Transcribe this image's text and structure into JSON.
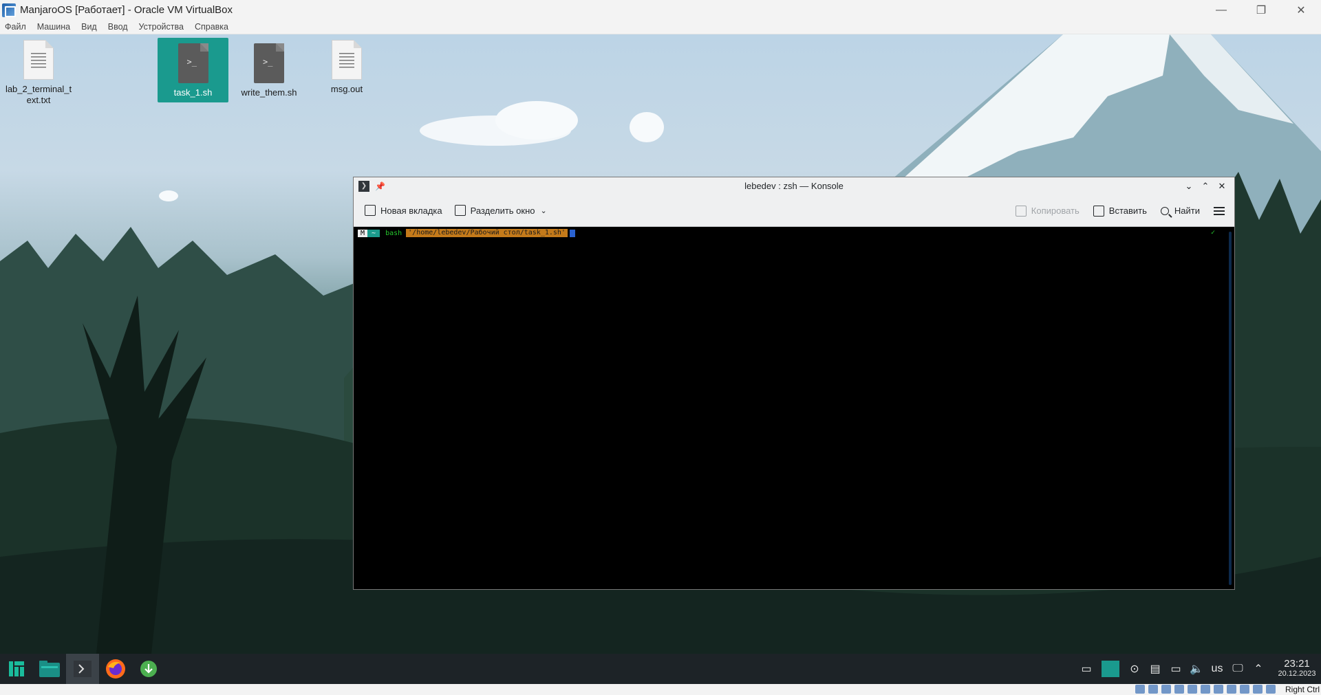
{
  "host_window": {
    "title": "ManjaroOS [Работает] - Oracle VM VirtualBox",
    "controls": {
      "minimize": "—",
      "restore": "❐",
      "close": "✕"
    },
    "menu": [
      "Файл",
      "Машина",
      "Вид",
      "Ввод",
      "Устройства",
      "Справка"
    ]
  },
  "desktop": {
    "icons": [
      {
        "label": "lab_2_terminal_text.txt",
        "type": "text-file-icon",
        "selected": false
      },
      {
        "label": "task_1.sh",
        "type": "script-file-icon",
        "selected": true
      },
      {
        "label": "write_them.sh",
        "type": "script-file-icon",
        "selected": false
      },
      {
        "label": "msg.out",
        "type": "text-file-icon",
        "selected": false
      }
    ]
  },
  "konsole": {
    "title": "lebedev : zsh — Konsole",
    "toolbar": {
      "new_tab": "Новая вкладка",
      "split_view": "Разделить окно",
      "copy": "Копировать",
      "paste": "Вставить",
      "find": "Найти"
    },
    "terminal": {
      "seg_icon": "M",
      "seg_home": "~",
      "shell": "bash",
      "path": "'/home/lebedev/Рабочий стол/task_1.sh'",
      "status_mark": "✓"
    }
  },
  "taskbar": {
    "apps": [
      "manjaro-menu-icon",
      "file-manager-icon",
      "konsole-icon",
      "firefox-icon",
      "update-icon"
    ],
    "keyboard_layout": "us",
    "time": "23:21",
    "date": "20.12.2023"
  },
  "vb_statusbar": {
    "host_key": "Right Ctrl"
  },
  "colors": {
    "selection": "#1a9a8e",
    "taskbar": "#1d2327",
    "prompt_path_bg": "#c47a1a"
  }
}
